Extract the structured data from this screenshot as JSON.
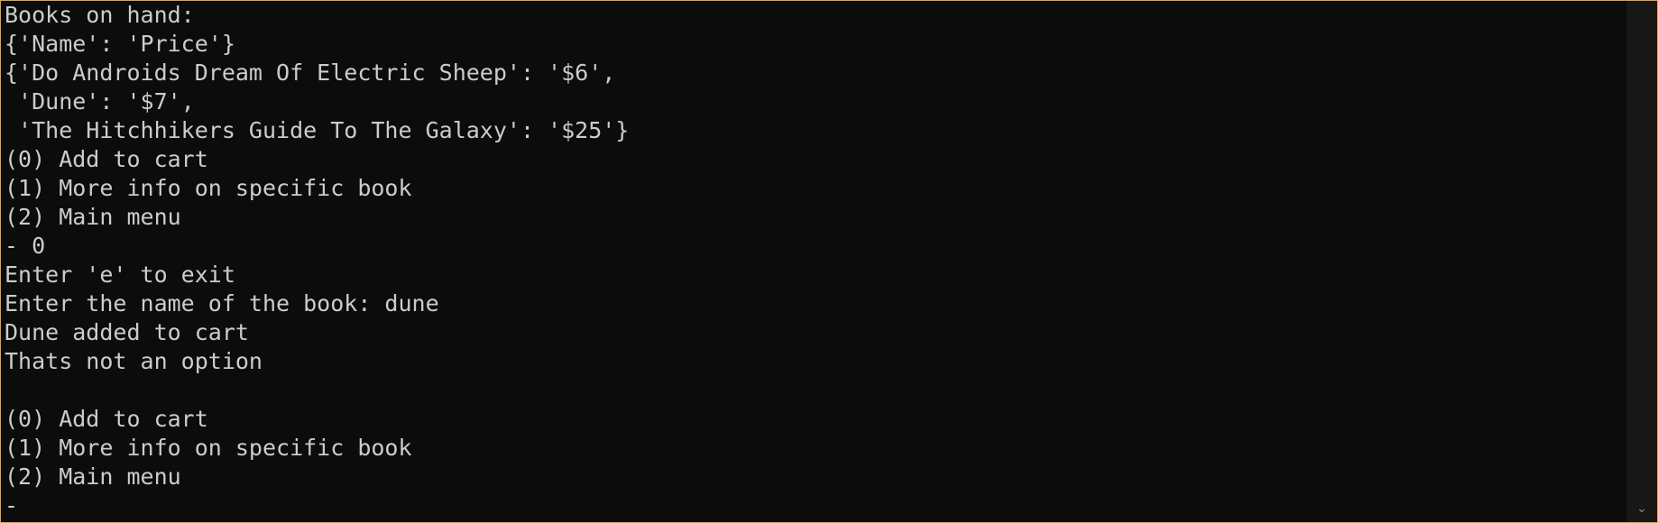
{
  "console": {
    "lines": [
      "Books on hand:",
      "{'Name': 'Price'}",
      "{'Do Androids Dream Of Electric Sheep': '$6',",
      " 'Dune': '$7',",
      " 'The Hitchhikers Guide To The Galaxy': '$25'}",
      "(0) Add to cart",
      "(1) More info on specific book",
      "(2) Main menu",
      "- 0",
      "Enter 'e' to exit",
      "Enter the name of the book: dune",
      "Dune added to cart",
      "Thats not an option",
      "",
      "(0) Add to cart",
      "(1) More info on specific book",
      "(2) Main menu",
      "-"
    ]
  },
  "scrollbar": {
    "up_icon": "chevron-up-icon",
    "down_icon": "chevron-down-icon",
    "up_glyph": "",
    "down_glyph": "⌄"
  },
  "colors": {
    "background": "#0c0c0c",
    "text": "#cccccc",
    "border": "#e8a33a"
  }
}
